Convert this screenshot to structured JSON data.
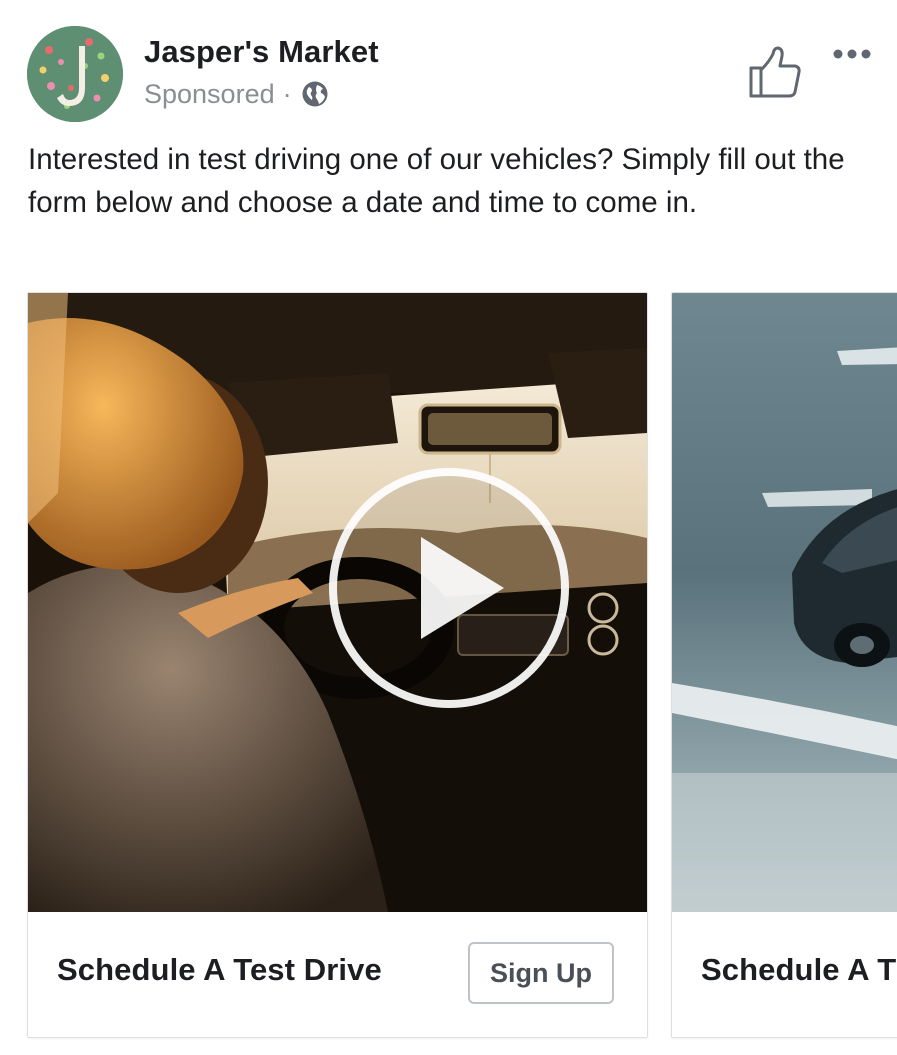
{
  "post": {
    "page_name": "Jasper's Market",
    "sponsored_label": "Sponsored",
    "separator": "·",
    "globe_icon": "globe-icon",
    "like_icon": "thumbs-up-icon",
    "more_icon": "more-options-icon",
    "text": "Interested in test driving one of our vehicles? Simply fill out the form below and choose a date and time to come in."
  },
  "carousel": {
    "cards": [
      {
        "media_type": "video",
        "play_icon": "play-icon",
        "headline": "Schedule A Test Drive",
        "cta_label": "Sign Up"
      },
      {
        "media_type": "image",
        "headline": "Schedule A T"
      }
    ]
  },
  "colors": {
    "text_primary": "#1c1e21",
    "text_secondary": "#8a8d91",
    "border": "#dddfe2",
    "button_border": "#bec3c9",
    "avatar_bg": "#5f8f73"
  }
}
